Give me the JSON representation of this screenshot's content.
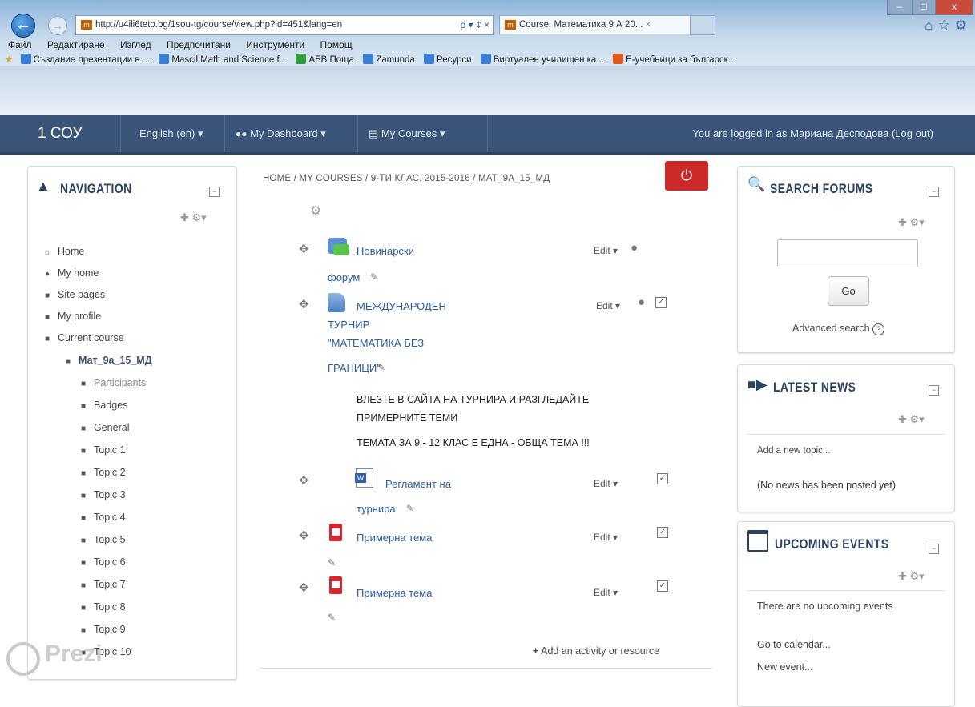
{
  "browser": {
    "url": "http://u4ili6teto.bg/1sou-tg/course/view.php?id=451&lang=en",
    "url_tools": "ρ ▾ ¢ ×",
    "tab_title": "Course: Математика 9 А 20...",
    "tab_close": "×",
    "menu": [
      "Файл",
      "Редактиране",
      "Изглед",
      "Предпочитани",
      "Инструменти",
      "Помощ"
    ],
    "favorites": [
      {
        "label": "Създание презентации в ...",
        "color": "#3a7fd4"
      },
      {
        "label": "Mascil Math and Science f...",
        "color": "#3a7fd4"
      },
      {
        "label": "АБВ Поща",
        "color": "#2e9e3c"
      },
      {
        "label": "Zamunda",
        "color": "#3a7fd4"
      },
      {
        "label": "Ресурси",
        "color": "#3a7fd4"
      },
      {
        "label": "Виртуален училищен ка...",
        "color": "#3a7fd4"
      },
      {
        "label": "Е-учебници за българск...",
        "color": "#e05a1e"
      }
    ]
  },
  "navbar": {
    "site_name": "1 СОУ",
    "language": "English (en) ▾",
    "dashboard": "My Dashboard ▾",
    "courses": "My Courses ▾",
    "logged_in": "You are logged in as Мариана Десподова (Log out)"
  },
  "navigation": {
    "title": "NAVIGATION",
    "items": [
      {
        "label": "Home",
        "icon": "home-icon"
      },
      {
        "label": "My home",
        "icon": "bullet-icon"
      },
      {
        "label": "Site pages",
        "icon": "folder-icon"
      },
      {
        "label": "My profile",
        "icon": "folder-icon"
      },
      {
        "label": "Current course",
        "icon": "folder-icon"
      },
      {
        "label": "Мат_9а_15_МД",
        "icon": "folder-icon"
      },
      {
        "label": "Participants",
        "icon": "folder-icon"
      },
      {
        "label": "Badges",
        "icon": "folder-icon"
      },
      {
        "label": "General",
        "icon": "folder-icon"
      },
      {
        "label": "Topic 1",
        "icon": "folder-icon"
      },
      {
        "label": "Topic 2",
        "icon": "folder-icon"
      },
      {
        "label": "Topic 3",
        "icon": "folder-icon"
      },
      {
        "label": "Topic 4",
        "icon": "folder-icon"
      },
      {
        "label": "Topic 5",
        "icon": "folder-icon"
      },
      {
        "label": "Topic 6",
        "icon": "folder-icon"
      },
      {
        "label": "Topic 7",
        "icon": "folder-icon"
      },
      {
        "label": "Topic 8",
        "icon": "folder-icon"
      },
      {
        "label": "Topic 9",
        "icon": "folder-icon"
      },
      {
        "label": "Topic 10",
        "icon": "folder-icon"
      }
    ]
  },
  "breadcrumb": "HOME / MY COURSES / 9-ТИ КЛАС, 2015-2016 / МАТ_9А_15_МД",
  "activities": {
    "forum_line1": "Новинарски",
    "forum_line2": "форум",
    "tournament_line1": "МЕЖДУНАРОДЕН",
    "tournament_line2": "ТУРНИР",
    "tournament_line3": "\"МАТЕМАТИКА БЕЗ",
    "tournament_line4": "ГРАНИЦИ\"",
    "label_line1": "ВЛЕЗТЕ В САЙТА НА ТУРНИРА  И  РАЗГЛЕДАЙТЕ",
    "label_line2": "ПРИМЕРНИТЕ ТЕМИ",
    "label_line3": "ТЕМАТА ЗА 9 - 12 КЛАС Е ЕДНА - ОБЩА ТЕМА !!!",
    "rules_line1": "Регламент на",
    "rules_line2": "турнира",
    "sample1": "Примерна тема",
    "sample2": "Примерна тема",
    "edit": "Edit ▾",
    "add_activity": "Add an activity or resource"
  },
  "search_forums": {
    "title": "SEARCH FORUMS",
    "go": "Go",
    "advanced": "Advanced search"
  },
  "latest_news": {
    "title": "LATEST NEWS",
    "add_topic": "Add a new topic...",
    "empty": "(No news has been posted yet)"
  },
  "upcoming_events": {
    "title": "UPCOMING EVENTS",
    "empty": "There are no upcoming events",
    "calendar": "Go to calendar...",
    "new_event": "New event..."
  },
  "watermark": "Prezi"
}
